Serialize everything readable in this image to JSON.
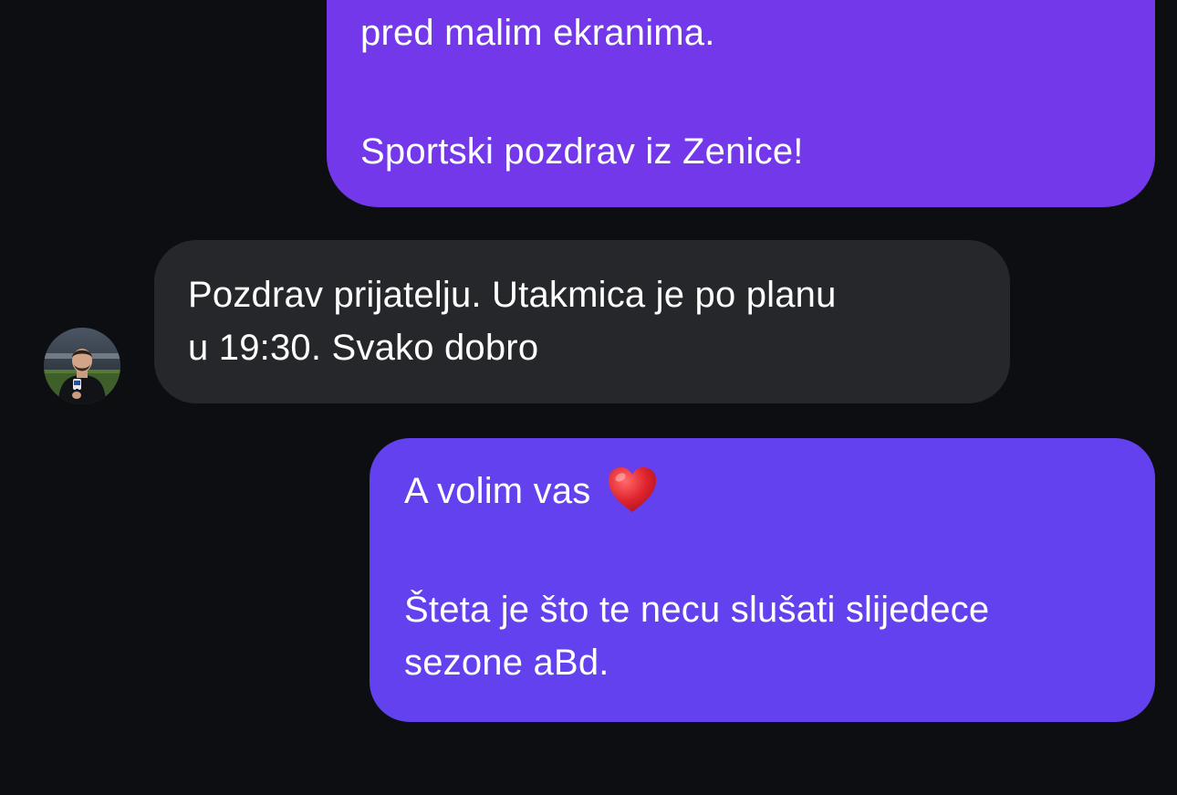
{
  "conversation": {
    "messages": [
      {
        "direction": "outgoing",
        "paragraphs": [
          "pred malim ekranima.",
          "Sportski pozdrav iz Zenice!"
        ]
      },
      {
        "direction": "incoming",
        "avatar_icon": "person-photo-avatar",
        "paragraphs": [
          "Pozdrav prijatelju. Utakmica je po planu\nu 19:30. Svako dobro"
        ]
      },
      {
        "direction": "outgoing",
        "paragraphs": [
          "A volim vas",
          "Šteta je što te necu slušati slijedece\nsezone aBd."
        ],
        "emoji": "heart-emoji"
      }
    ]
  },
  "theme": {
    "background": "#0c0e12",
    "outgoing_bubble_top": "#7338ea",
    "outgoing_bubble_bottom": "#6341ee",
    "incoming_bubble": "#25272b",
    "text": "#ffffff",
    "heart": "#e0242e"
  }
}
